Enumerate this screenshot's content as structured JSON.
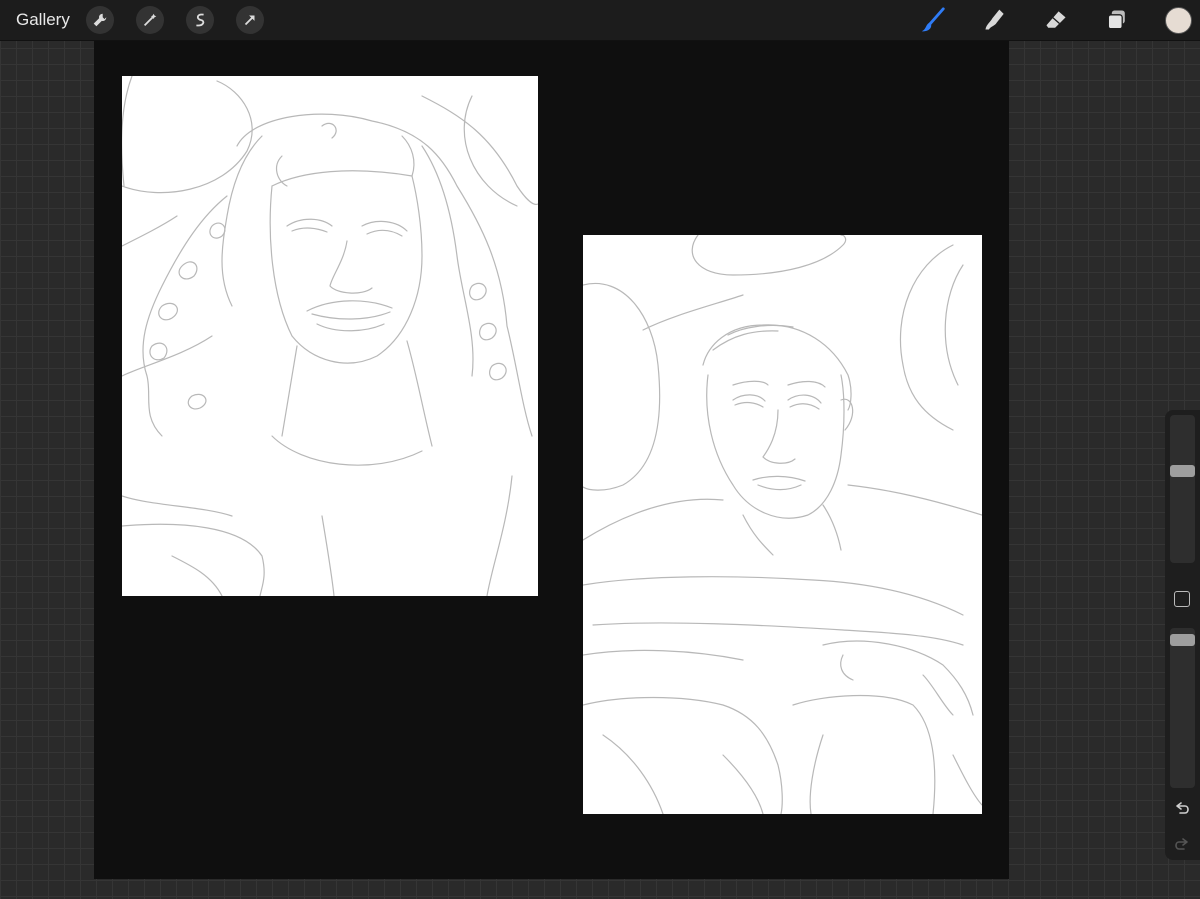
{
  "toolbar": {
    "gallery_label": "Gallery",
    "left_tools": [
      "wrench-icon",
      "magic-wand-icon",
      "selection-icon",
      "transform-arrow-icon"
    ],
    "right_tools": [
      "brush-icon",
      "smudge-icon",
      "eraser-icon",
      "layers-icon"
    ],
    "active_tool": "brush",
    "accent_color": "#2f7cf6",
    "current_color": "#e6dcd3"
  },
  "sidebar": {
    "brush_size": 0.63,
    "brush_opacity": 0.96,
    "controls": [
      "brush-size-slider",
      "modify-square-button",
      "brush-opacity-slider",
      "undo-icon",
      "redo-icon"
    ]
  },
  "canvas": {
    "background": "#0f0f0f",
    "sheets": [
      "sketch-woman-curly-hair",
      "sketch-man-arms-crossed"
    ]
  }
}
